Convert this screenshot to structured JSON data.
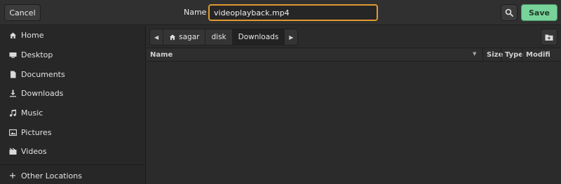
{
  "header": {
    "cancel_label": "Cancel",
    "name_label": "Name",
    "filename_value": "videoplayback.mp4",
    "save_label": "Save",
    "search_icon": "search-icon"
  },
  "sidebar": {
    "items": [
      {
        "label": "Home",
        "icon": "home-icon"
      },
      {
        "label": "Desktop",
        "icon": "desktop-icon"
      },
      {
        "label": "Documents",
        "icon": "document-icon"
      },
      {
        "label": "Downloads",
        "icon": "download-icon"
      },
      {
        "label": "Music",
        "icon": "music-icon"
      },
      {
        "label": "Pictures",
        "icon": "picture-icon"
      },
      {
        "label": "Videos",
        "icon": "video-icon"
      }
    ],
    "other_locations": "Other Locations"
  },
  "pathbar": {
    "crumbs": [
      "sagar",
      "disk",
      "Downloads"
    ]
  },
  "columns": {
    "name": "Name",
    "size": "Size",
    "type": "Type",
    "modified": "Modified"
  },
  "colors": {
    "accent_focus": "#e29a2e",
    "save_bg": "#78d39a"
  }
}
